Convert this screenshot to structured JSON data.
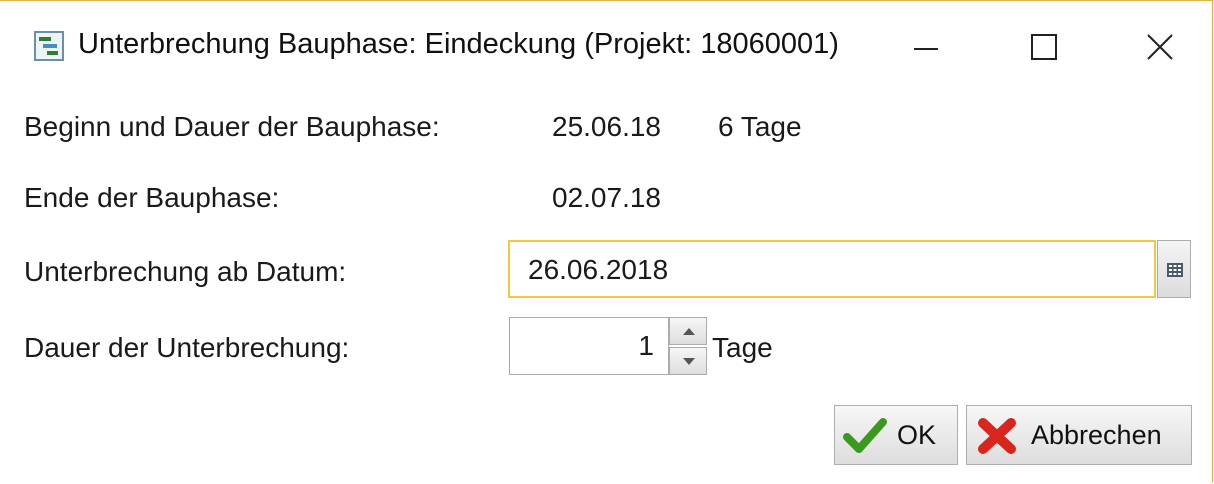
{
  "window": {
    "title": "Unterbrechung Bauphase: Eindeckung (Projekt: 18060001)"
  },
  "info": {
    "beginn_label": "Beginn und Dauer der Bauphase:",
    "beginn_date": "25.06.18",
    "beginn_duration": "6 Tage",
    "ende_label": "Ende der Bauphase:",
    "ende_date": "02.07.18"
  },
  "form": {
    "ab_datum_label": "Unterbrechung ab Datum:",
    "ab_datum_value": "26.06.2018",
    "dauer_label": "Dauer der Unterbrechung:",
    "dauer_value": "1",
    "dauer_unit": "Tage"
  },
  "buttons": {
    "ok_label": "OK",
    "cancel_label": "Abbrechen"
  },
  "icons": {
    "app": "gantt-app-icon",
    "calendar": "calendar-icon",
    "ok": "checkmark-icon",
    "cancel": "red-x-icon"
  },
  "colors": {
    "focus_border": "#f0c846",
    "window_border": "#e2b04a",
    "ok_check": "#3a9a1e",
    "cancel_x": "#d8261f"
  }
}
